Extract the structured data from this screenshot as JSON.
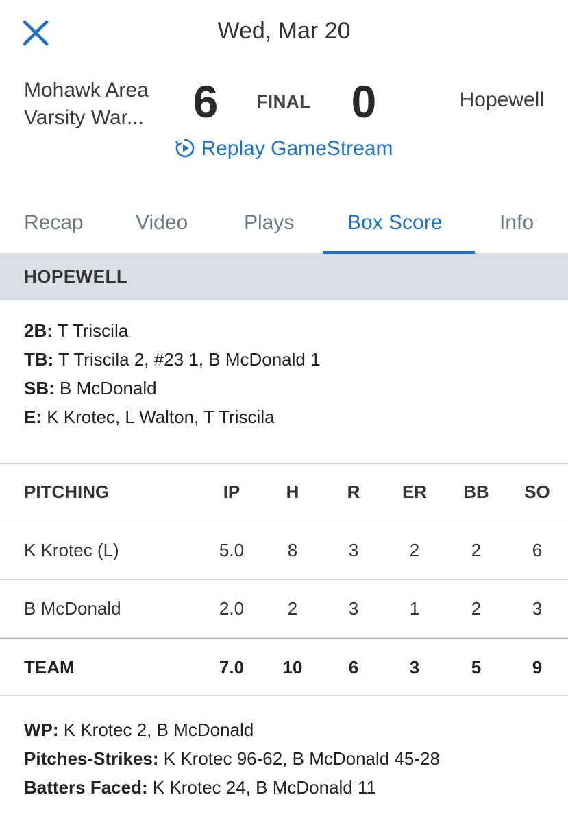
{
  "header": {
    "date": "Wed, Mar 20"
  },
  "score": {
    "away_name_line1": "Mohawk Area",
    "away_name_line2": "Varsity War...",
    "away_score": "6",
    "status": "FINAL",
    "home_score": "0",
    "home_name": "Hopewell"
  },
  "replay_label": "Replay GameStream",
  "tabs": [
    {
      "label": "Recap"
    },
    {
      "label": "Video"
    },
    {
      "label": "Plays"
    },
    {
      "label": "Box Score",
      "active": true
    },
    {
      "label": "Info"
    }
  ],
  "team_header": "HOPEWELL",
  "batting_notes": [
    {
      "label": "2B:",
      "value": " T Triscila"
    },
    {
      "label": "TB:",
      "value": " T Triscila 2, #23 1, B McDonald 1"
    },
    {
      "label": "SB:",
      "value": " B McDonald"
    },
    {
      "label": "E:",
      "value": " K Krotec, L Walton, T Triscila"
    }
  ],
  "pitching": {
    "columns": [
      "PITCHING",
      "IP",
      "H",
      "R",
      "ER",
      "BB",
      "SO"
    ],
    "rows": [
      [
        "K Krotec (L)",
        "5.0",
        "8",
        "3",
        "2",
        "2",
        "6"
      ],
      [
        "B McDonald",
        "2.0",
        "2",
        "3",
        "1",
        "2",
        "3"
      ]
    ],
    "totals": [
      "TEAM",
      "7.0",
      "10",
      "6",
      "3",
      "5",
      "9"
    ]
  },
  "pitching_notes": [
    {
      "label": "WP:",
      "value": " K Krotec 2, B McDonald"
    },
    {
      "label": "Pitches-Strikes:",
      "value": " K Krotec 96-62, B McDonald 45-28"
    },
    {
      "label": "Batters Faced:",
      "value": " K Krotec 24, B McDonald 11"
    }
  ],
  "colors": {
    "accent": "#1a73c9",
    "header_band": "#d9dfe5",
    "tab_inactive": "#6b7a88"
  },
  "icons": {
    "close": "close-icon",
    "replay": "replay-play-icon"
  }
}
